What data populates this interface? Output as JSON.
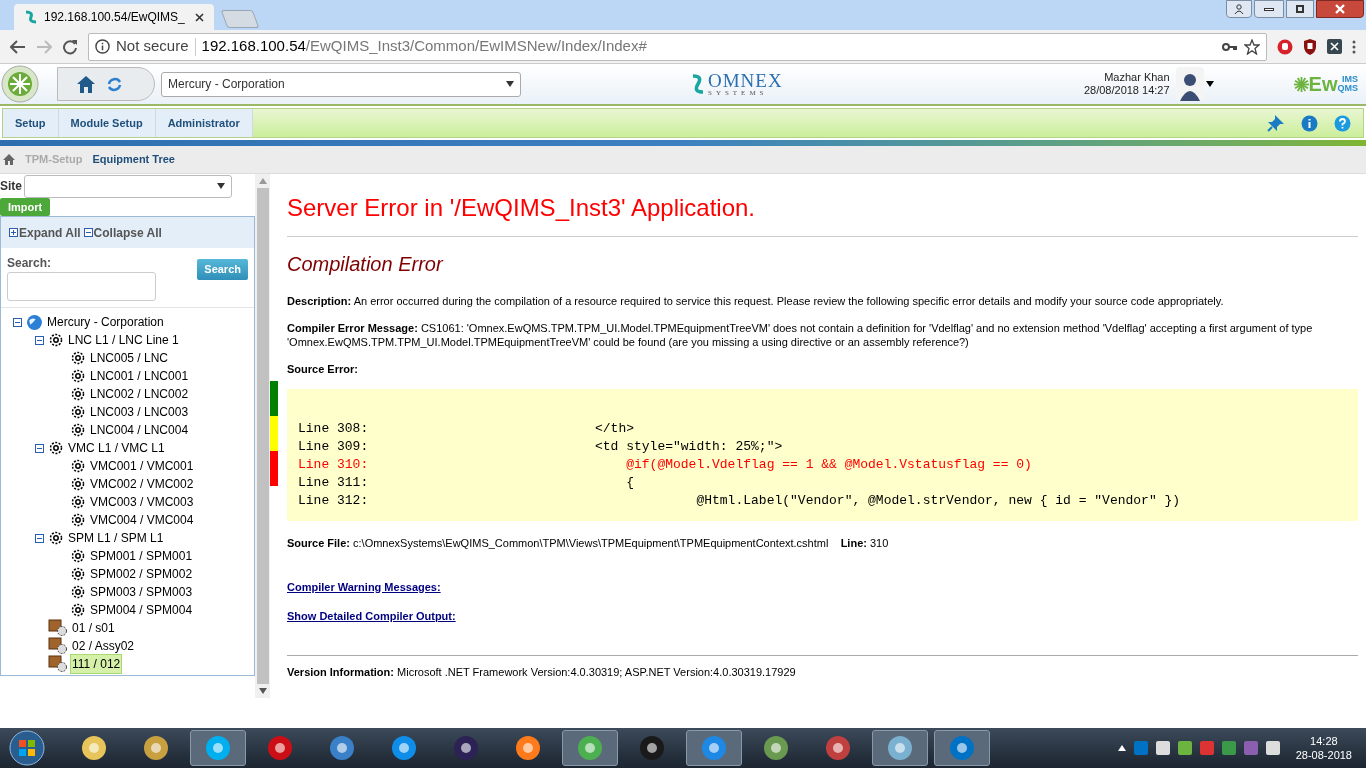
{
  "browser": {
    "tab_title": "192.168.100.54/EwQIMS_",
    "url_security": "Not secure",
    "url_host": "192.168.100.54",
    "url_path": "/EwQIMS_Inst3/Common/EwIMSNew/Index/Index#"
  },
  "header": {
    "company_select": "Mercury - Corporation",
    "logo_main": "OMNEX",
    "logo_sub": "SYSTEMS",
    "user_name": "Mazhar Khan",
    "datetime": "28/08/2018 14:27",
    "brand": "Ew",
    "brand_top": "IMS",
    "brand_bottom": "QMS"
  },
  "menu": [
    {
      "label": "Setup"
    },
    {
      "label": "Module Setup"
    },
    {
      "label": "Administrator"
    }
  ],
  "breadcrumb": [
    {
      "label": "TPM-Setup",
      "selected": false
    },
    {
      "label": "Equipment Tree",
      "selected": true
    }
  ],
  "left_panel": {
    "site_label": "Site",
    "import_button": "Import",
    "expand_all": "Expand All",
    "collapse_all": "Collapse All",
    "search_label": "Search:",
    "search_button": "Search",
    "tree": [
      {
        "label": "Mercury - Corporation",
        "kind": "root",
        "expanded": true,
        "selected": false,
        "children": [
          {
            "label": "LNC L1 / LNC Line 1",
            "kind": "line",
            "expanded": true,
            "selected": false,
            "children": [
              {
                "label": "LNC005 / LNC",
                "kind": "machine",
                "selected": false
              },
              {
                "label": "LNC001 / LNC001",
                "kind": "machine",
                "selected": false
              },
              {
                "label": "LNC002 / LNC002",
                "kind": "machine",
                "selected": false
              },
              {
                "label": "LNC003 / LNC003",
                "kind": "machine",
                "selected": false
              },
              {
                "label": "LNC004 / LNC004",
                "kind": "machine",
                "selected": false
              }
            ]
          },
          {
            "label": "VMC L1 / VMC L1",
            "kind": "line",
            "expanded": true,
            "selected": false,
            "children": [
              {
                "label": "VMC001 / VMC001",
                "kind": "machine",
                "selected": false
              },
              {
                "label": "VMC002 / VMC002",
                "kind": "machine",
                "selected": false
              },
              {
                "label": "VMC003 / VMC003",
                "kind": "machine",
                "selected": false
              },
              {
                "label": "VMC004 / VMC004",
                "kind": "machine",
                "selected": false
              }
            ]
          },
          {
            "label": "SPM L1 / SPM L1",
            "kind": "line",
            "expanded": true,
            "selected": false,
            "children": [
              {
                "label": "SPM001 / SPM001",
                "kind": "machine",
                "selected": false
              },
              {
                "label": "SPM002 / SPM002",
                "kind": "machine",
                "selected": false
              },
              {
                "label": "SPM003 / SPM003",
                "kind": "machine",
                "selected": false
              },
              {
                "label": "SPM004 / SPM004",
                "kind": "machine",
                "selected": false
              }
            ]
          },
          {
            "label": "01 / s01",
            "kind": "assembly",
            "selected": false
          },
          {
            "label": "02 / Assy02",
            "kind": "assembly",
            "selected": false
          },
          {
            "label": "111 / 012",
            "kind": "assembly",
            "selected": true
          }
        ]
      }
    ]
  },
  "status_strip": [
    {
      "color": "#008000"
    },
    {
      "color": "#ffff00"
    },
    {
      "color": "#ff0000"
    }
  ],
  "error_page": {
    "title": "Server Error in '/EwQIMS_Inst3' Application.",
    "subtitle": "Compilation Error",
    "description": "**Description:** An error occurred during the compilation of a resource required to service this request. Please review the following specific error details and modify your source code appropriately.",
    "compiler_message": "**Compiler Error Message:** CS1061: 'Omnex.EwQMS.TPM.TPM_UI.Model.TPMEquipmentTreeVM' does not contain a definition for 'Vdelflag' and no extension method 'Vdelflag' accepting a first argument of type 'Omnex.EwQMS.TPM.TPM_UI.Model.TPMEquipmentTreeVM' could be found (are you missing a using directive or an assembly reference?)",
    "source_error_label": "Source Error:",
    "source_lines": [
      {
        "number": "Line 308:",
        "code": "</th>",
        "highlighted": false
      },
      {
        "number": "Line 309:",
        "code": "<td style=\"width: 25%;\">",
        "highlighted": false
      },
      {
        "number": "Line 310:",
        "code": "    @if(@Model.Vdelflag == 1 && @Model.Vstatusflag == 0)",
        "highlighted": true
      },
      {
        "number": "Line 311:",
        "code": "    {",
        "highlighted": false
      },
      {
        "number": "Line 312:",
        "code": "             @Html.Label(\"Vendor\", @Model.strVendor, new { id = \"Vendor\" })",
        "highlighted": false
      }
    ],
    "source_file": "**Source File:** c:\\OmnexSystems\\EwQIMS_Common\\TPM\\Views\\TPMEquipment\\TPMEquipmentContext.cshtml    **Line:** 310",
    "links": [
      "Compiler Warning Messages:",
      "Show Detailed Compiler Output:"
    ],
    "version": "**Version Information:** Microsoft .NET Framework Version:4.0.30319; ASP.NET Version:4.0.30319.17929"
  },
  "taskbar": {
    "time": "14:28",
    "date": "28-08-2018"
  }
}
